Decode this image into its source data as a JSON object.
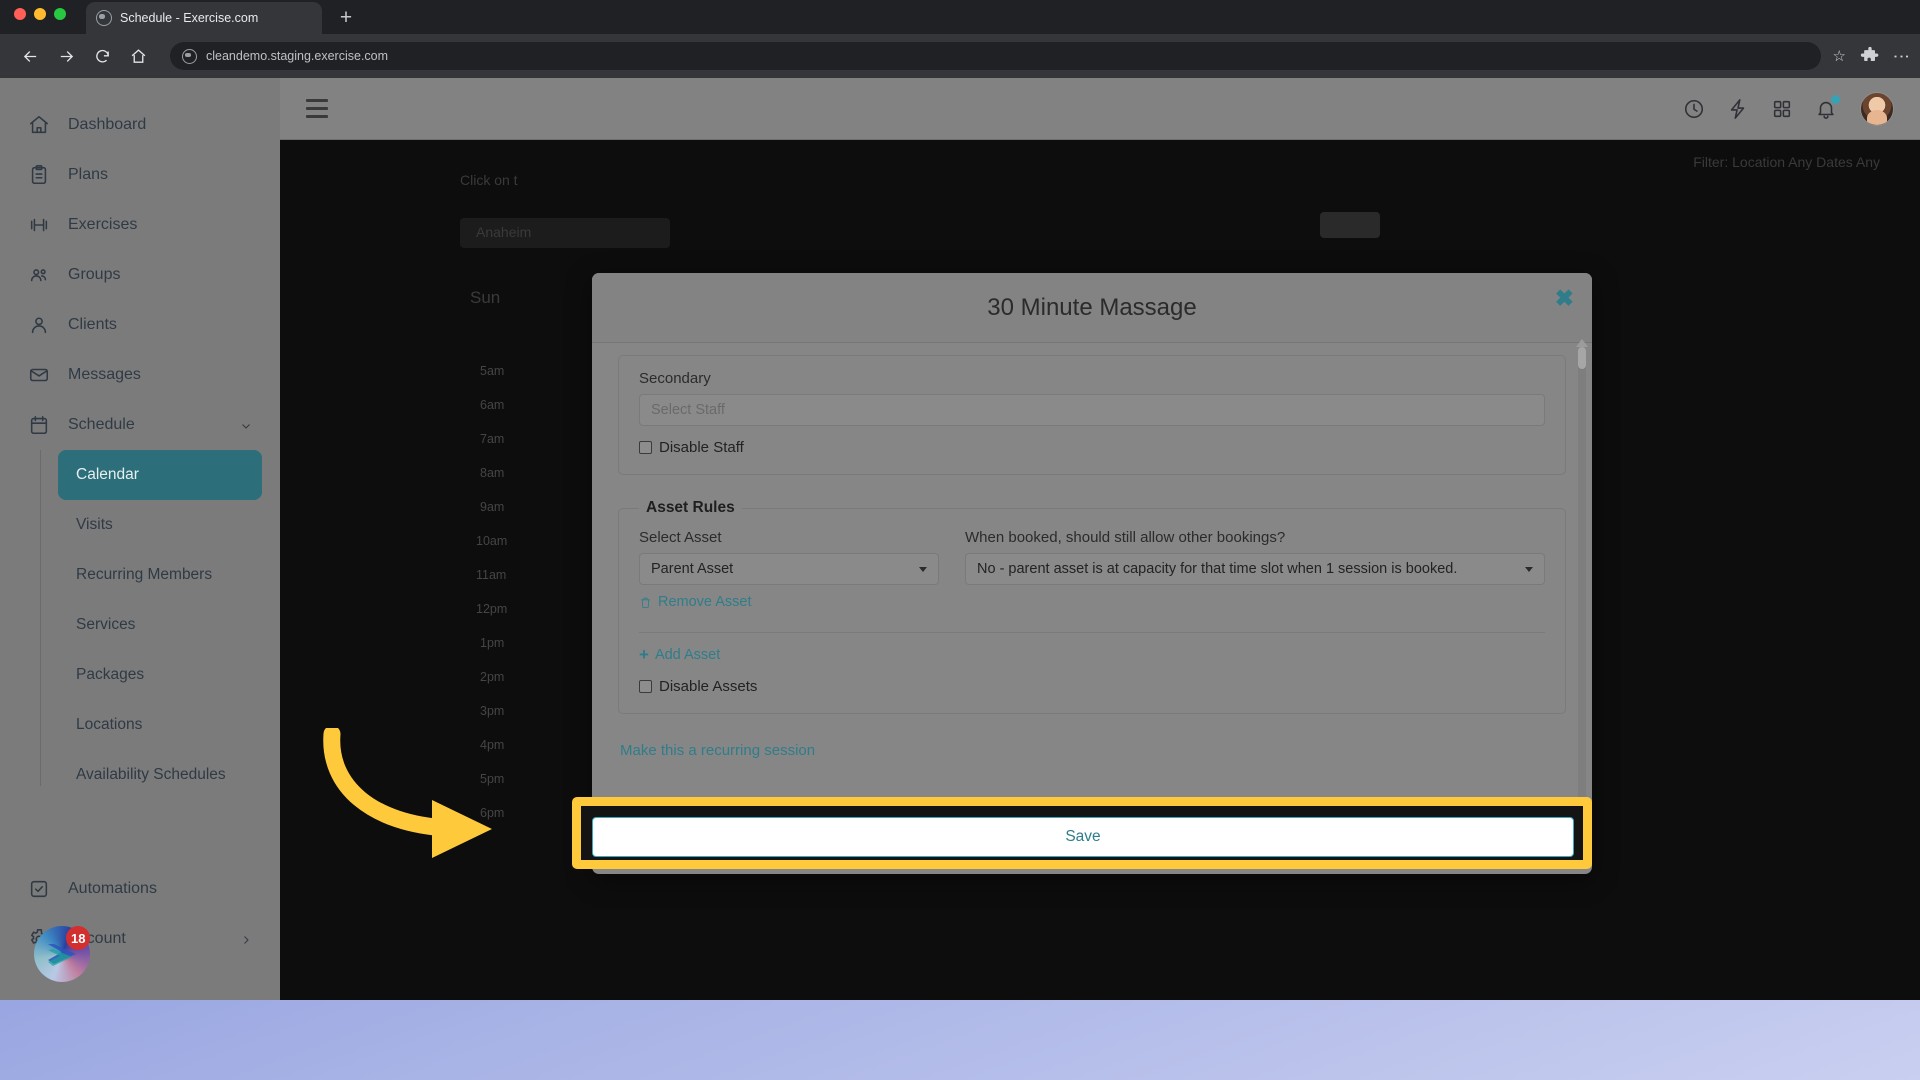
{
  "browser": {
    "tab_title": "Schedule - Exercise.com",
    "new_tab_label": "+",
    "url": "cleandemo.staging.exercise.com",
    "star_glyph": "☆",
    "kebab_glyph": "⋮"
  },
  "sidebar": {
    "items": [
      {
        "label": "Dashboard",
        "icon": "home-icon"
      },
      {
        "label": "Plans",
        "icon": "clipboard-icon"
      },
      {
        "label": "Exercises",
        "icon": "dumbbell-icon"
      },
      {
        "label": "Groups",
        "icon": "people-icon"
      },
      {
        "label": "Clients",
        "icon": "user-icon"
      },
      {
        "label": "Messages",
        "icon": "envelope-icon"
      },
      {
        "label": "Schedule",
        "icon": "calendar-icon"
      }
    ],
    "sub_items": [
      {
        "label": "Calendar",
        "active": true
      },
      {
        "label": "Visits",
        "active": false
      },
      {
        "label": "Recurring Members",
        "active": false
      },
      {
        "label": "Services",
        "active": false
      },
      {
        "label": "Packages",
        "active": false
      },
      {
        "label": "Locations",
        "active": false
      },
      {
        "label": "Availability Schedules",
        "active": false
      }
    ],
    "bottom_items": [
      {
        "label": "Automations",
        "icon": "checkbox-square-icon"
      },
      {
        "label": "Account",
        "icon": "gear-icon"
      }
    ],
    "app_badge_count": "18"
  },
  "appbar": {
    "icons": [
      {
        "name": "clock-icon"
      },
      {
        "name": "lightning-icon"
      },
      {
        "name": "grid-apps-icon"
      },
      {
        "name": "bell-icon"
      }
    ]
  },
  "modal": {
    "title": "30 Minute Massage",
    "close_glyph": "✖",
    "secondary_label": "Secondary",
    "secondary_placeholder": "Select Staff",
    "disable_staff_label": "Disable Staff",
    "asset_rules_legend": "Asset Rules",
    "select_asset_label": "Select Asset",
    "select_asset_value": "Parent Asset",
    "allow_bookings_label": "When booked, should still allow other bookings?",
    "allow_bookings_value": "No - parent asset is at capacity for that time slot when 1 session is booked.",
    "remove_asset_label": "Remove Asset",
    "add_asset_label": "Add Asset",
    "add_asset_plus": "+",
    "disable_assets_label": "Disable Assets",
    "recurring_link": "Make this a recurring session",
    "save_label": "Save"
  },
  "background_page": {
    "hint_text": "Click on t",
    "filter_text": "Filter: Location Any Dates Any",
    "location_chip": "Anaheim",
    "day_label": "Sun",
    "hours": [
      "5am",
      "6am",
      "7am",
      "8am",
      "9am",
      "10am",
      "11am",
      "12pm",
      "1pm",
      "2pm",
      "3pm",
      "4pm",
      "5pm",
      "6pm"
    ]
  },
  "colors": {
    "accent_teal": "#2f7d8a",
    "active_nav": "#2c6e79",
    "highlight_yellow": "#ffc93c",
    "badge_red": "#d32f2f",
    "notification_dot": "#36a3b5"
  }
}
